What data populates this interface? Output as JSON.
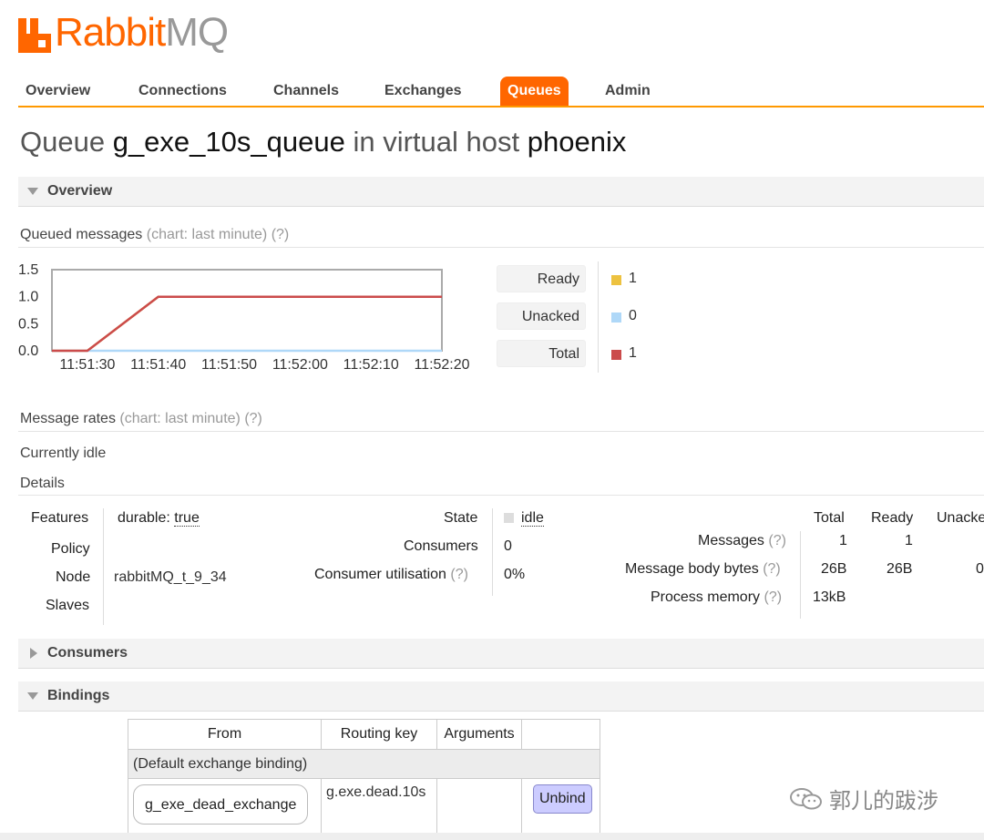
{
  "logo": {
    "rabbit": "Rabbit",
    "mq": "MQ"
  },
  "nav": {
    "tabs": [
      {
        "label": "Overview",
        "active": false
      },
      {
        "label": "Connections",
        "active": false
      },
      {
        "label": "Channels",
        "active": false
      },
      {
        "label": "Exchanges",
        "active": false
      },
      {
        "label": "Queues",
        "active": true
      },
      {
        "label": "Admin",
        "active": false
      }
    ]
  },
  "title": {
    "prefix": "Queue",
    "queue_name": "g_exe_10s_queue",
    "middle": "in virtual host",
    "vhost": "phoenix"
  },
  "sections": {
    "overview": "Overview",
    "consumers": "Consumers",
    "bindings": "Bindings"
  },
  "queued_messages": {
    "label": "Queued messages",
    "chart_note": "(chart: last minute)",
    "help": "(?)"
  },
  "chart_data": {
    "type": "line",
    "title": "",
    "x": [
      "11:51:25",
      "11:51:30",
      "11:51:40",
      "11:51:50",
      "11:52:00",
      "11:52:10",
      "11:52:20"
    ],
    "x_tick_labels": [
      "11:51:30",
      "11:51:40",
      "11:51:50",
      "11:52:00",
      "11:52:10",
      "11:52:20"
    ],
    "ylim": [
      0,
      1.5
    ],
    "y_tick_labels": [
      "1.5",
      "1.0",
      "0.5",
      "0.0"
    ],
    "series": [
      {
        "name": "Ready",
        "color": "#edc240",
        "points": [
          [
            "11:51:25",
            0
          ],
          [
            "11:51:30",
            0
          ],
          [
            "11:51:40",
            1
          ],
          [
            "11:52:20",
            1
          ]
        ]
      },
      {
        "name": "Unacked",
        "color": "#afd8f8",
        "points": [
          [
            "11:51:25",
            0
          ],
          [
            "11:52:20",
            0
          ]
        ]
      },
      {
        "name": "Total",
        "color": "#cb4b4b",
        "points": [
          [
            "11:51:25",
            0
          ],
          [
            "11:51:30",
            0
          ],
          [
            "11:51:40",
            1
          ],
          [
            "11:52:20",
            1
          ]
        ]
      }
    ]
  },
  "legend": [
    {
      "label": "Ready",
      "value": "1",
      "color": "#edc240"
    },
    {
      "label": "Unacked",
      "value": "0",
      "color": "#afd8f8"
    },
    {
      "label": "Total",
      "value": "1",
      "color": "#cb4b4b"
    }
  ],
  "message_rates": {
    "label": "Message rates",
    "chart_note": "(chart: last minute)",
    "help": "(?)"
  },
  "currently_idle": "Currently idle",
  "details": {
    "label": "Details",
    "features_label": "Features",
    "features_key": "durable:",
    "features_value": "true",
    "policy_label": "Policy",
    "node_label": "Node",
    "node_value": "rabbitMQ_t_9_34",
    "slaves_label": "Slaves",
    "state_label": "State",
    "state_value": "idle",
    "consumers_label": "Consumers",
    "consumers_value": "0",
    "utilisation_label": "Consumer utilisation",
    "utilisation_help": "(?)",
    "utilisation_value": "0%",
    "stats_headers": [
      "Total",
      "Ready",
      "Unacke"
    ],
    "messages_label": "Messages",
    "messages_help": "(?)",
    "messages_total": "1",
    "messages_ready": "1",
    "body_bytes_label": "Message body bytes",
    "body_bytes_help": "(?)",
    "body_bytes_total": "26B",
    "body_bytes_ready": "26B",
    "body_bytes_unacked": "0",
    "process_memory_label": "Process memory",
    "process_memory_help": "(?)",
    "process_memory_total": "13kB"
  },
  "bindings_table": {
    "headers": [
      "From",
      "Routing key",
      "Arguments",
      ""
    ],
    "default_binding": "(Default exchange binding)",
    "row": {
      "from": "g_exe_dead_exchange",
      "routing_key": "g.exe.dead.10s",
      "arguments": "",
      "action": "Unbind"
    }
  },
  "watermark": "郭儿的跋涉"
}
